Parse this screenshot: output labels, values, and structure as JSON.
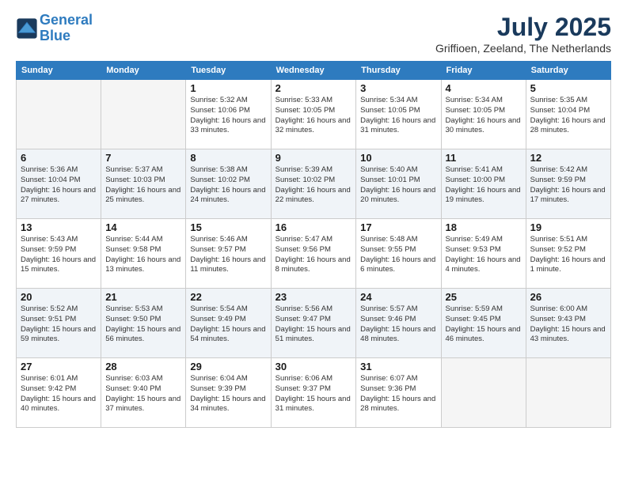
{
  "logo": {
    "line1": "General",
    "line2": "Blue"
  },
  "title": "July 2025",
  "location": "Griffioen, Zeeland, The Netherlands",
  "weekdays": [
    "Sunday",
    "Monday",
    "Tuesday",
    "Wednesday",
    "Thursday",
    "Friday",
    "Saturday"
  ],
  "weeks": [
    [
      {
        "day": "",
        "info": ""
      },
      {
        "day": "",
        "info": ""
      },
      {
        "day": "1",
        "info": "Sunrise: 5:32 AM\nSunset: 10:06 PM\nDaylight: 16 hours\nand 33 minutes."
      },
      {
        "day": "2",
        "info": "Sunrise: 5:33 AM\nSunset: 10:05 PM\nDaylight: 16 hours\nand 32 minutes."
      },
      {
        "day": "3",
        "info": "Sunrise: 5:34 AM\nSunset: 10:05 PM\nDaylight: 16 hours\nand 31 minutes."
      },
      {
        "day": "4",
        "info": "Sunrise: 5:34 AM\nSunset: 10:05 PM\nDaylight: 16 hours\nand 30 minutes."
      },
      {
        "day": "5",
        "info": "Sunrise: 5:35 AM\nSunset: 10:04 PM\nDaylight: 16 hours\nand 28 minutes."
      }
    ],
    [
      {
        "day": "6",
        "info": "Sunrise: 5:36 AM\nSunset: 10:04 PM\nDaylight: 16 hours\nand 27 minutes."
      },
      {
        "day": "7",
        "info": "Sunrise: 5:37 AM\nSunset: 10:03 PM\nDaylight: 16 hours\nand 25 minutes."
      },
      {
        "day": "8",
        "info": "Sunrise: 5:38 AM\nSunset: 10:02 PM\nDaylight: 16 hours\nand 24 minutes."
      },
      {
        "day": "9",
        "info": "Sunrise: 5:39 AM\nSunset: 10:02 PM\nDaylight: 16 hours\nand 22 minutes."
      },
      {
        "day": "10",
        "info": "Sunrise: 5:40 AM\nSunset: 10:01 PM\nDaylight: 16 hours\nand 20 minutes."
      },
      {
        "day": "11",
        "info": "Sunrise: 5:41 AM\nSunset: 10:00 PM\nDaylight: 16 hours\nand 19 minutes."
      },
      {
        "day": "12",
        "info": "Sunrise: 5:42 AM\nSunset: 9:59 PM\nDaylight: 16 hours\nand 17 minutes."
      }
    ],
    [
      {
        "day": "13",
        "info": "Sunrise: 5:43 AM\nSunset: 9:59 PM\nDaylight: 16 hours\nand 15 minutes."
      },
      {
        "day": "14",
        "info": "Sunrise: 5:44 AM\nSunset: 9:58 PM\nDaylight: 16 hours\nand 13 minutes."
      },
      {
        "day": "15",
        "info": "Sunrise: 5:46 AM\nSunset: 9:57 PM\nDaylight: 16 hours\nand 11 minutes."
      },
      {
        "day": "16",
        "info": "Sunrise: 5:47 AM\nSunset: 9:56 PM\nDaylight: 16 hours\nand 8 minutes."
      },
      {
        "day": "17",
        "info": "Sunrise: 5:48 AM\nSunset: 9:55 PM\nDaylight: 16 hours\nand 6 minutes."
      },
      {
        "day": "18",
        "info": "Sunrise: 5:49 AM\nSunset: 9:53 PM\nDaylight: 16 hours\nand 4 minutes."
      },
      {
        "day": "19",
        "info": "Sunrise: 5:51 AM\nSunset: 9:52 PM\nDaylight: 16 hours\nand 1 minute."
      }
    ],
    [
      {
        "day": "20",
        "info": "Sunrise: 5:52 AM\nSunset: 9:51 PM\nDaylight: 15 hours\nand 59 minutes."
      },
      {
        "day": "21",
        "info": "Sunrise: 5:53 AM\nSunset: 9:50 PM\nDaylight: 15 hours\nand 56 minutes."
      },
      {
        "day": "22",
        "info": "Sunrise: 5:54 AM\nSunset: 9:49 PM\nDaylight: 15 hours\nand 54 minutes."
      },
      {
        "day": "23",
        "info": "Sunrise: 5:56 AM\nSunset: 9:47 PM\nDaylight: 15 hours\nand 51 minutes."
      },
      {
        "day": "24",
        "info": "Sunrise: 5:57 AM\nSunset: 9:46 PM\nDaylight: 15 hours\nand 48 minutes."
      },
      {
        "day": "25",
        "info": "Sunrise: 5:59 AM\nSunset: 9:45 PM\nDaylight: 15 hours\nand 46 minutes."
      },
      {
        "day": "26",
        "info": "Sunrise: 6:00 AM\nSunset: 9:43 PM\nDaylight: 15 hours\nand 43 minutes."
      }
    ],
    [
      {
        "day": "27",
        "info": "Sunrise: 6:01 AM\nSunset: 9:42 PM\nDaylight: 15 hours\nand 40 minutes."
      },
      {
        "day": "28",
        "info": "Sunrise: 6:03 AM\nSunset: 9:40 PM\nDaylight: 15 hours\nand 37 minutes."
      },
      {
        "day": "29",
        "info": "Sunrise: 6:04 AM\nSunset: 9:39 PM\nDaylight: 15 hours\nand 34 minutes."
      },
      {
        "day": "30",
        "info": "Sunrise: 6:06 AM\nSunset: 9:37 PM\nDaylight: 15 hours\nand 31 minutes."
      },
      {
        "day": "31",
        "info": "Sunrise: 6:07 AM\nSunset: 9:36 PM\nDaylight: 15 hours\nand 28 minutes."
      },
      {
        "day": "",
        "info": ""
      },
      {
        "day": "",
        "info": ""
      }
    ]
  ]
}
